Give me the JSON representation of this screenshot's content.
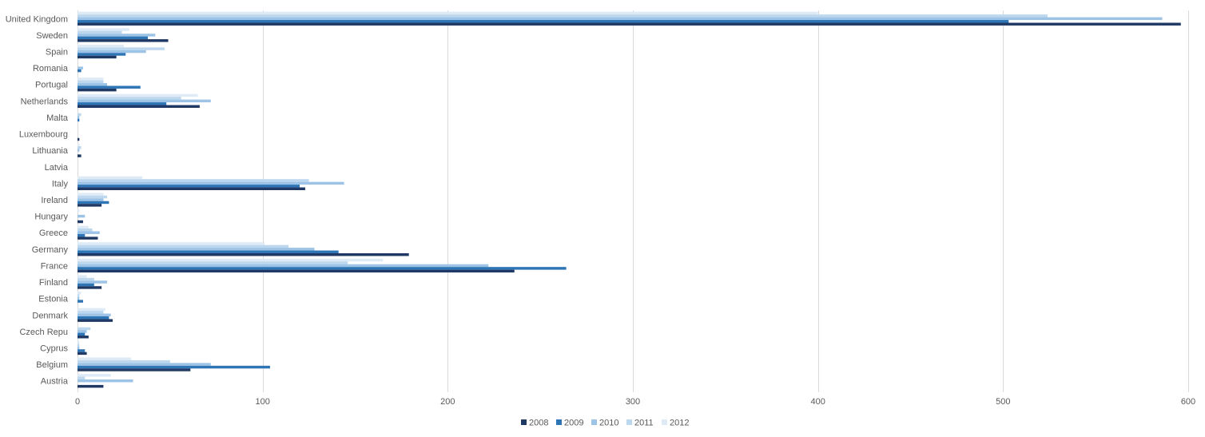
{
  "chart_data": {
    "type": "bar",
    "orientation": "horizontal",
    "title": "",
    "xlabel": "",
    "ylabel": "",
    "xlim": [
      0,
      600
    ],
    "x_ticks": [
      "0",
      "100",
      "200",
      "300",
      "400",
      "500",
      "600"
    ],
    "x_tick_values": [
      0,
      100,
      200,
      300,
      400,
      500,
      600
    ],
    "grid": "vertical",
    "legend_position": "bottom",
    "categories": [
      "United Kingdom",
      "Sweden",
      "Spain",
      "Romania",
      "Portugal",
      "Netherlands",
      "Malta",
      "Luxembourg",
      "Lithuania",
      "Latvia",
      "Italy",
      "Ireland",
      "Hungary",
      "Greece",
      "Germany",
      "France",
      "Finland",
      "Estonia",
      "Denmark",
      "Czech Repu",
      "Cyprus",
      "Belgium",
      "Austria"
    ],
    "series": [
      {
        "name": "2008",
        "color": "#203864",
        "values": [
          596,
          49,
          21,
          0,
          21,
          66,
          0,
          1,
          2,
          0,
          123,
          13,
          3,
          11,
          179,
          236,
          13,
          0,
          19,
          6,
          5,
          61,
          14
        ]
      },
      {
        "name": "2009",
        "color": "#2e75b6",
        "values": [
          503,
          38,
          26,
          2,
          34,
          48,
          1,
          0,
          0,
          0,
          120,
          17,
          0,
          4,
          141,
          264,
          9,
          3,
          17,
          4,
          4,
          104,
          0
        ]
      },
      {
        "name": "2010",
        "color": "#9dc3e6",
        "values": [
          586,
          42,
          37,
          3,
          16,
          72,
          1,
          0,
          1,
          0,
          144,
          14,
          4,
          12,
          128,
          222,
          16,
          1,
          18,
          5,
          1,
          72,
          30
        ]
      },
      {
        "name": "2011",
        "color": "#bdd7ee",
        "values": [
          524,
          24,
          47,
          0,
          14,
          56,
          2,
          0,
          2,
          0,
          125,
          16,
          0,
          8,
          114,
          146,
          9,
          1,
          14,
          7,
          1,
          50,
          4
        ]
      },
      {
        "name": "2012",
        "color": "#deebf7",
        "values": [
          400,
          28,
          25,
          0,
          14,
          65,
          0,
          0,
          1,
          0,
          35,
          14,
          1,
          6,
          101,
          165,
          5,
          2,
          15,
          0,
          1,
          29,
          18
        ]
      }
    ]
  }
}
